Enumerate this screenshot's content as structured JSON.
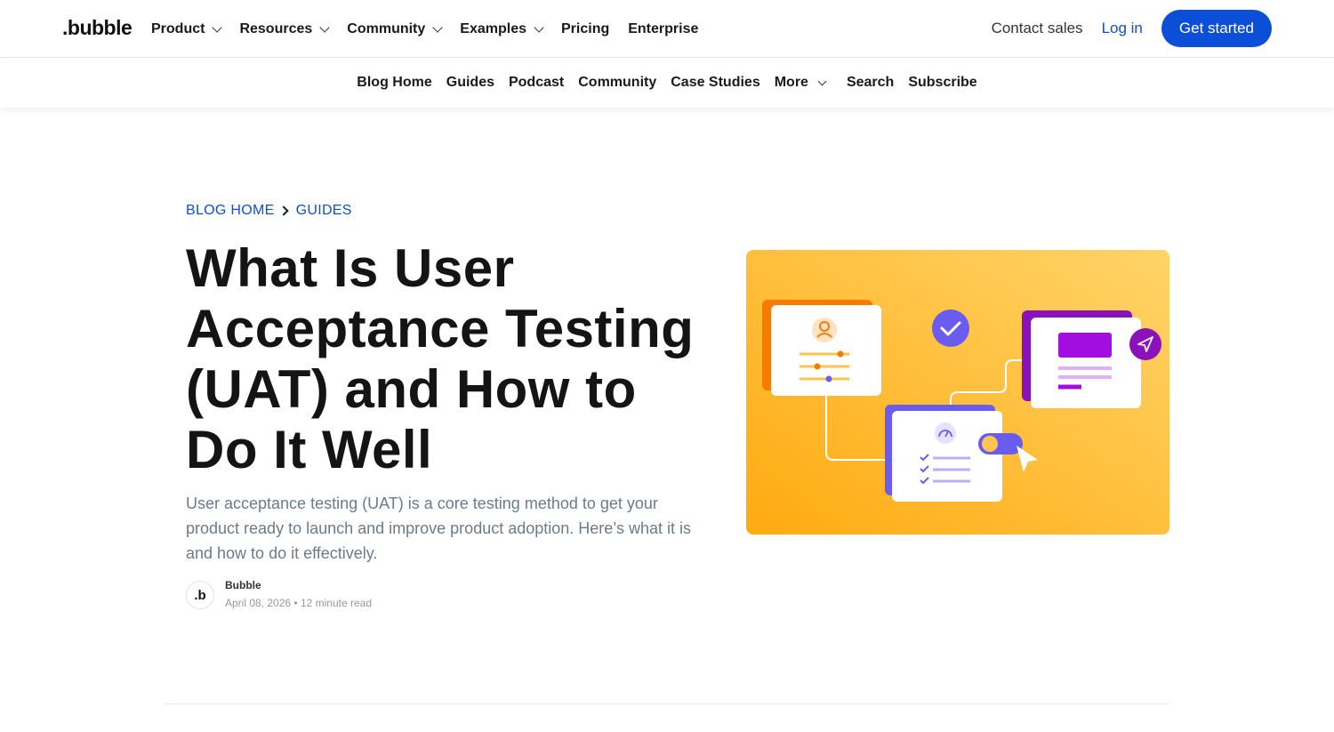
{
  "header": {
    "logo": ".bubble",
    "menu": [
      {
        "label": "Product",
        "dropdown": true
      },
      {
        "label": "Resources",
        "dropdown": true
      },
      {
        "label": "Community",
        "dropdown": true
      },
      {
        "label": "Examples",
        "dropdown": true
      },
      {
        "label": "Pricing",
        "dropdown": false
      },
      {
        "label": "Enterprise",
        "dropdown": false
      }
    ],
    "contact_sales": "Contact sales",
    "login": "Log in",
    "get_started": "Get started"
  },
  "subnav": {
    "items": [
      "Blog Home",
      "Guides",
      "Podcast",
      "Community",
      "Case Studies",
      "More",
      "Search",
      "Subscribe"
    ]
  },
  "breadcrumb": {
    "home": "BLOG HOME",
    "current": "GUIDES"
  },
  "article": {
    "title": "What Is User Acceptance Testing (UAT) and How to Do It Well",
    "subtitle": "User acceptance testing (UAT) is a core testing method to get your product ready to launch and improve product adoption. Here’s what it is and how to do it effectively.",
    "author": "Bubble",
    "avatar_letter": ".b",
    "date": "April 08, 2026",
    "read_time": "12 minute read"
  },
  "colors": {
    "brand_blue": "#0b4fd8",
    "hero_orange": "#ffb21c",
    "purple": "#7b3fe4",
    "violet": "#9b1fd9"
  }
}
